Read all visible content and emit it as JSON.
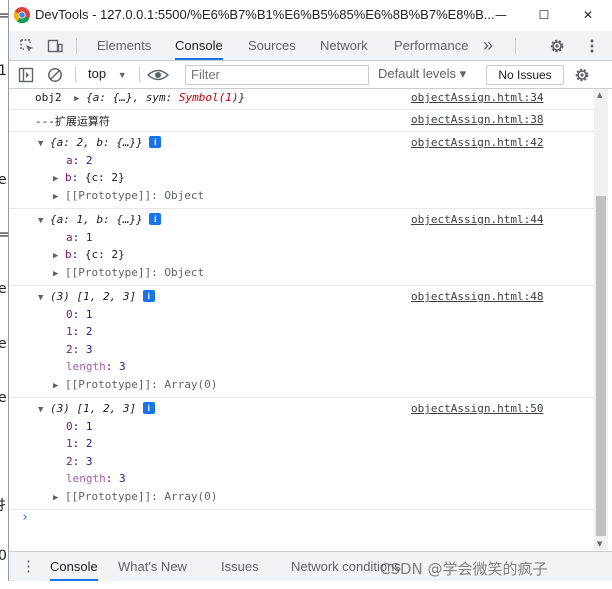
{
  "window": {
    "title": "DevTools - 127.0.0.1:5500/%E6%B7%B1%E6%B5%85%E6%8B%B7%E8%B...",
    "minimize": "—",
    "maximize": "☐",
    "close": "✕"
  },
  "left_strip": [
    "=",
    "1",
    "e",
    "=",
    "e",
    "e",
    "e",
    "扌",
    "0"
  ],
  "tabs": [
    {
      "label": "Elements"
    },
    {
      "label": "Console"
    },
    {
      "label": "Sources"
    },
    {
      "label": "Network"
    },
    {
      "label": "Performance"
    }
  ],
  "more_tabs": "»",
  "toolbar": {
    "context": "top",
    "filter_placeholder": "Filter",
    "levels": "Default levels ▾",
    "issues": "No Issues"
  },
  "console": {
    "log1": {
      "label": "obj2",
      "preview_prefix": "{a: {…}, sym: ",
      "preview_sym": "Symbol(1)",
      "preview_suffix": "}",
      "source": "objectAssign.html:34"
    },
    "log2": {
      "text": "---扩展运算符",
      "source": "objectAssign.html:38"
    },
    "log3": {
      "header": "{a: 2, b: {…}}",
      "source": "objectAssign.html:42",
      "a_key": "a",
      "a_val": "2",
      "b_key": "b",
      "b_val": "{c: 2}",
      "proto": "[[Prototype]]: Object"
    },
    "log4": {
      "header": "{a: 1, b: {…}}",
      "source": "objectAssign.html:44",
      "a_key": "a",
      "a_val": "1",
      "b_key": "b",
      "b_val": "{c: 2}",
      "proto": "[[Prototype]]: Object"
    },
    "log5": {
      "header": "(3) [1, 2, 3]",
      "source": "objectAssign.html:48",
      "items": [
        {
          "k": "0",
          "v": "1"
        },
        {
          "k": "1",
          "v": "2"
        },
        {
          "k": "2",
          "v": "3"
        }
      ],
      "length_key": "length",
      "length_val": "3",
      "proto": "[[Prototype]]: Array(0)"
    },
    "log6": {
      "header": "(3) [1, 2, 3]",
      "source": "objectAssign.html:50",
      "items": [
        {
          "k": "0",
          "v": "1"
        },
        {
          "k": "1",
          "v": "2"
        },
        {
          "k": "2",
          "v": "3"
        }
      ],
      "length_key": "length",
      "length_val": "3",
      "proto": "[[Prototype]]: Array(0)"
    },
    "prompt": "›"
  },
  "drawer": {
    "menu": "⋮",
    "tabs": [
      "Console",
      "What's New",
      "Issues",
      "Network conditions"
    ]
  },
  "watermark": "CSDN @学会微笑的疯子",
  "colors": {
    "accent": "#1a73e8",
    "key": "#881280",
    "number": "#1a1aa6",
    "symbol": "#c80000"
  }
}
